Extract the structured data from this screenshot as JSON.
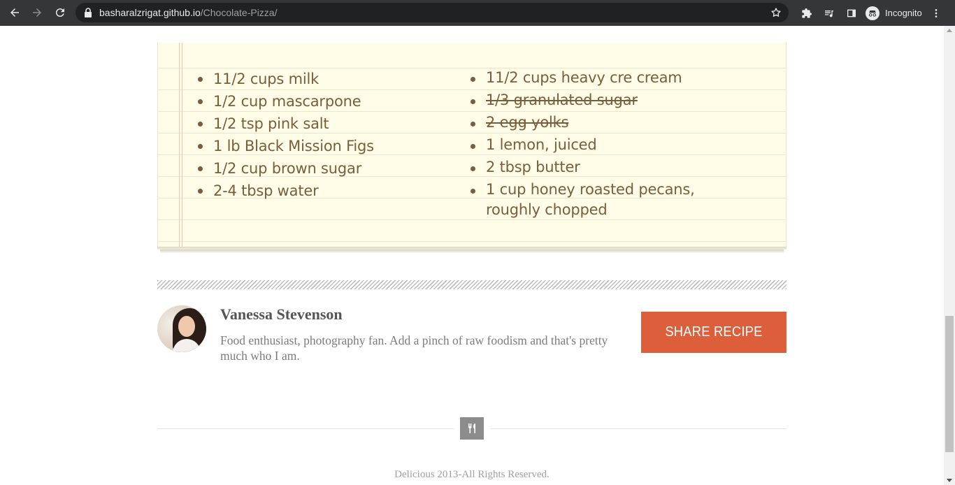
{
  "browser": {
    "url_domain": "basharalzrigat.github.io",
    "url_path": "/Chocolate-Pizza/",
    "profile_label": "Incognito"
  },
  "ingredients": {
    "left": [
      {
        "text": "11/2 cups milk",
        "checked": false
      },
      {
        "text": "1/2 cup mascarpone",
        "checked": false
      },
      {
        "text": "1/2 tsp pink salt",
        "checked": false
      },
      {
        "text": "1 lb Black Mission Figs",
        "checked": false
      },
      {
        "text": "1/2 cup brown sugar",
        "checked": false
      },
      {
        "text": "2-4 tbsp water",
        "checked": false
      }
    ],
    "right": [
      {
        "text": "11/2 cups heavy cre cream",
        "checked": false
      },
      {
        "text": "1/3 granulated sugar",
        "checked": true
      },
      {
        "text": "2 egg yolks",
        "checked": true
      },
      {
        "text": "1 lemon, juiced",
        "checked": false
      },
      {
        "text": "2 tbsp butter",
        "checked": false
      },
      {
        "text": "1 cup honey roasted pecans, roughly chopped",
        "checked": false
      }
    ]
  },
  "author": {
    "name": "Vanessa Stevenson",
    "bio": "Food enthusiast, photography fan. Add a pinch of raw foodism and that's pretty much who I am."
  },
  "share_button_label": "SHARE RECIPE",
  "footer": {
    "icon": "fork-knife-icon",
    "copyright": "Delicious 2013-All Rights Reserved."
  },
  "colors": {
    "accent": "#dc5e3b",
    "ink": "#7a5d3b",
    "paper": "#fffce8",
    "chrome": "#35363a"
  }
}
